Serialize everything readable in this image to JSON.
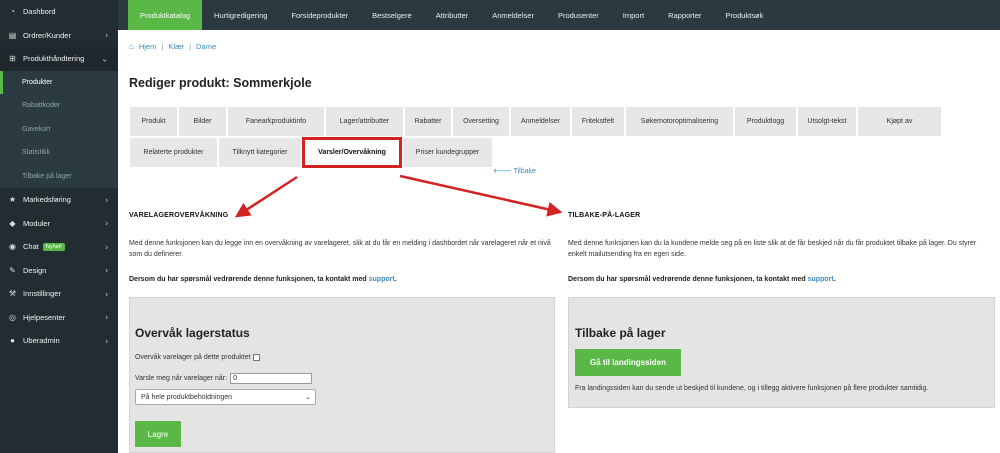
{
  "sidebar": {
    "items": [
      {
        "label": "Dashbord",
        "icon": "gauge-icon",
        "has_chevron": false
      },
      {
        "label": "Ordrer/Kunder",
        "icon": "inbox-icon",
        "has_chevron": true
      },
      {
        "label": "Produkthåndtering",
        "icon": "cart-icon",
        "has_chevron": true
      }
    ],
    "subitems": [
      {
        "label": "Produkter",
        "active": true
      },
      {
        "label": "Rabattkoder",
        "active": false
      },
      {
        "label": "Gavekort",
        "active": false
      },
      {
        "label": "Statistikk",
        "active": false
      },
      {
        "label": "Tilbake på lager",
        "active": false
      }
    ],
    "items2": [
      {
        "label": "Markedsføring",
        "icon": "star-icon"
      },
      {
        "label": "Moduler",
        "icon": "cube-icon"
      },
      {
        "label": "Chat",
        "icon": "chat-icon",
        "badge": "Nyhet!"
      },
      {
        "label": "Design",
        "icon": "pencil-icon"
      },
      {
        "label": "Innstillinger",
        "icon": "wrench-icon"
      },
      {
        "label": "Hjelpesenter",
        "icon": "lifering-icon"
      },
      {
        "label": "Uberadmin",
        "icon": "user-icon"
      }
    ]
  },
  "topnav": [
    "Produktkatalog",
    "Hurtigredigering",
    "Forsideprodukter",
    "Bestselgere",
    "Attributter",
    "Anmeldelser",
    "Produsenter",
    "Import",
    "Rapporter",
    "Produktsøk"
  ],
  "breadcrumb": {
    "home": "Hjem",
    "sep": "|",
    "crumbs": [
      "Klær",
      "Dame"
    ]
  },
  "page_title": "Rediger produkt: Sommerkjole",
  "tabs": {
    "row1": [
      "Produkt",
      "Bilder",
      "Fanearkproduktinfo",
      "Lager/attributter",
      "Rabatter",
      "Oversetting",
      "Anmeldelser",
      "Fritekstfelt",
      "Søkemotoroptimalisering",
      "Produktlogg",
      "Utsolgt-tekst",
      "Kjøpt av"
    ],
    "row2": [
      "Relaterte produkter",
      "Tilknytt kategorier",
      "Varsler/Overvåkning",
      "Priser kundegrupper"
    ],
    "active": "Varsler/Overvåkning"
  },
  "back_link": "Tilbake",
  "left": {
    "heading": "VARELAGEROVERVÅKNING",
    "desc": "Med denne funksjonen kan du legge inn en overvåkning av varelageret, slik at du får en melding i dashbordet når varelageret når et nivå som du definerer.",
    "contact_pre": "Dersom du har spørsmål vedrørende denne funksjonen, ta kontakt med ",
    "contact_link": "support",
    "contact_post": ".",
    "panel_title": "Overvåk lagerstatus",
    "check_label": "Overvåk varelager på dette produktet",
    "notify_label": "Varsle meg når varelager når:",
    "notify_value": "0",
    "select_value": "På hele produktbeholdningen",
    "save_label": "Lagre"
  },
  "right": {
    "heading": "TILBAKE-PÅ-LAGER",
    "desc": "Med denne funksjonen kan du la kundene melde seg på en liste slik at de får beskjed når du får produktet tilbake på lager. Du styrer enkelt mailutsending fra en egen side.",
    "contact_pre": "Dersom du har spørsmål vedrørende denne funksjonen, ta kontakt med ",
    "contact_link": "support",
    "contact_post": ".",
    "panel_title": "Tilbake på lager",
    "button_label": "Gå til landingssiden",
    "note": "Fra landingssiden kan du sende ut beskjed til kundene, og i tillegg aktivere funksjonen på flere produkter samtidig."
  },
  "colors": {
    "accent_green": "#59b846",
    "sidebar_bg": "#222d32",
    "link_blue": "#3c8dbc",
    "highlight_red": "#d32222"
  }
}
